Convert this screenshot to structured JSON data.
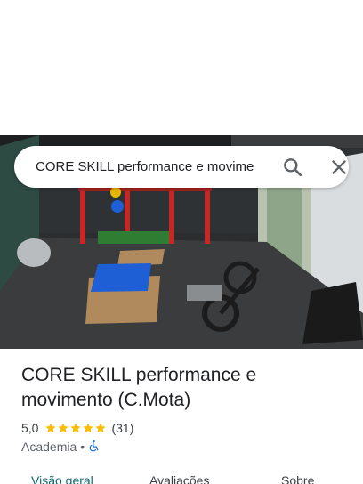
{
  "search": {
    "query": "CORE SKILL performance e movime"
  },
  "place": {
    "name": "CORE SKILL performance e movimento (C.Mota)",
    "rating": "5,0",
    "stars": 5,
    "review_count": "(31)",
    "category": "Academia",
    "separator": "•"
  },
  "tabs": [
    {
      "label": "Visão geral",
      "active": true
    },
    {
      "label": "Avaliações",
      "active": false
    },
    {
      "label": "Sobre",
      "active": false
    }
  ],
  "colors": {
    "star": "#fbbc04",
    "accessibility": "#1a73e8",
    "active_tab": "#0b6b6f"
  },
  "icons": {
    "search": "search-icon",
    "close": "close-icon",
    "accessibility": "wheelchair-icon"
  }
}
